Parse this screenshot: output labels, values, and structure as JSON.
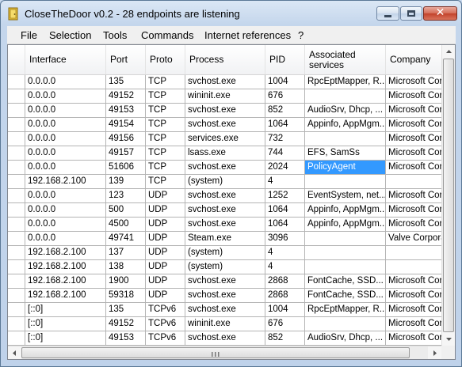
{
  "window": {
    "title": "CloseTheDoor v0.2 - 28 endpoints are listening"
  },
  "menu": [
    "File",
    "Selection",
    "Tools",
    "Commands",
    "Internet references",
    "?"
  ],
  "columns": [
    "Interface",
    "Port",
    "Proto",
    "Process",
    "PID",
    "Associated services",
    "Company"
  ],
  "rows": [
    [
      "0.0.0.0",
      "135",
      "TCP",
      "svchost.exe",
      "1004",
      "RpcEptMapper, R...",
      "Microsoft Corp"
    ],
    [
      "0.0.0.0",
      "49152",
      "TCP",
      "wininit.exe",
      "676",
      "",
      "Microsoft Corp"
    ],
    [
      "0.0.0.0",
      "49153",
      "TCP",
      "svchost.exe",
      "852",
      "AudioSrv, Dhcp, ...",
      "Microsoft Corp"
    ],
    [
      "0.0.0.0",
      "49154",
      "TCP",
      "svchost.exe",
      "1064",
      "Appinfo, AppMgm...",
      "Microsoft Corp"
    ],
    [
      "0.0.0.0",
      "49156",
      "TCP",
      "services.exe",
      "732",
      "",
      "Microsoft Corp"
    ],
    [
      "0.0.0.0",
      "49157",
      "TCP",
      "lsass.exe",
      "744",
      "EFS, SamSs",
      "Microsoft Corp"
    ],
    [
      "0.0.0.0",
      "51606",
      "TCP",
      "svchost.exe",
      "2024",
      "PolicyAgent",
      "Microsoft Corp"
    ],
    [
      "192.168.2.100",
      "139",
      "TCP",
      "(system)",
      "4",
      "",
      ""
    ],
    [
      "0.0.0.0",
      "123",
      "UDP",
      "svchost.exe",
      "1252",
      "EventSystem, net...",
      "Microsoft Corp"
    ],
    [
      "0.0.0.0",
      "500",
      "UDP",
      "svchost.exe",
      "1064",
      "Appinfo, AppMgm...",
      "Microsoft Corp"
    ],
    [
      "0.0.0.0",
      "4500",
      "UDP",
      "svchost.exe",
      "1064",
      "Appinfo, AppMgm...",
      "Microsoft Corp"
    ],
    [
      "0.0.0.0",
      "49741",
      "UDP",
      "Steam.exe",
      "3096",
      "",
      "Valve Corporati"
    ],
    [
      "192.168.2.100",
      "137",
      "UDP",
      "(system)",
      "4",
      "",
      ""
    ],
    [
      "192.168.2.100",
      "138",
      "UDP",
      "(system)",
      "4",
      "",
      ""
    ],
    [
      "192.168.2.100",
      "1900",
      "UDP",
      "svchost.exe",
      "2868",
      "FontCache, SSD...",
      "Microsoft Corp"
    ],
    [
      "192.168.2.100",
      "59318",
      "UDP",
      "svchost.exe",
      "2868",
      "FontCache, SSD...",
      "Microsoft Corp"
    ],
    [
      "[::0]",
      "135",
      "TCPv6",
      "svchost.exe",
      "1004",
      "RpcEptMapper, R...",
      "Microsoft Corp"
    ],
    [
      "[::0]",
      "49152",
      "TCPv6",
      "wininit.exe",
      "676",
      "",
      "Microsoft Corp"
    ],
    [
      "[::0]",
      "49153",
      "TCPv6",
      "svchost.exe",
      "852",
      "AudioSrv, Dhcp, ...",
      "Microsoft Corp"
    ]
  ],
  "selected": {
    "row": 6,
    "col": 5
  },
  "colors": {
    "selection": "#3399ff",
    "title_bar": "#c4d6ec",
    "close_button": "#c2412a"
  }
}
